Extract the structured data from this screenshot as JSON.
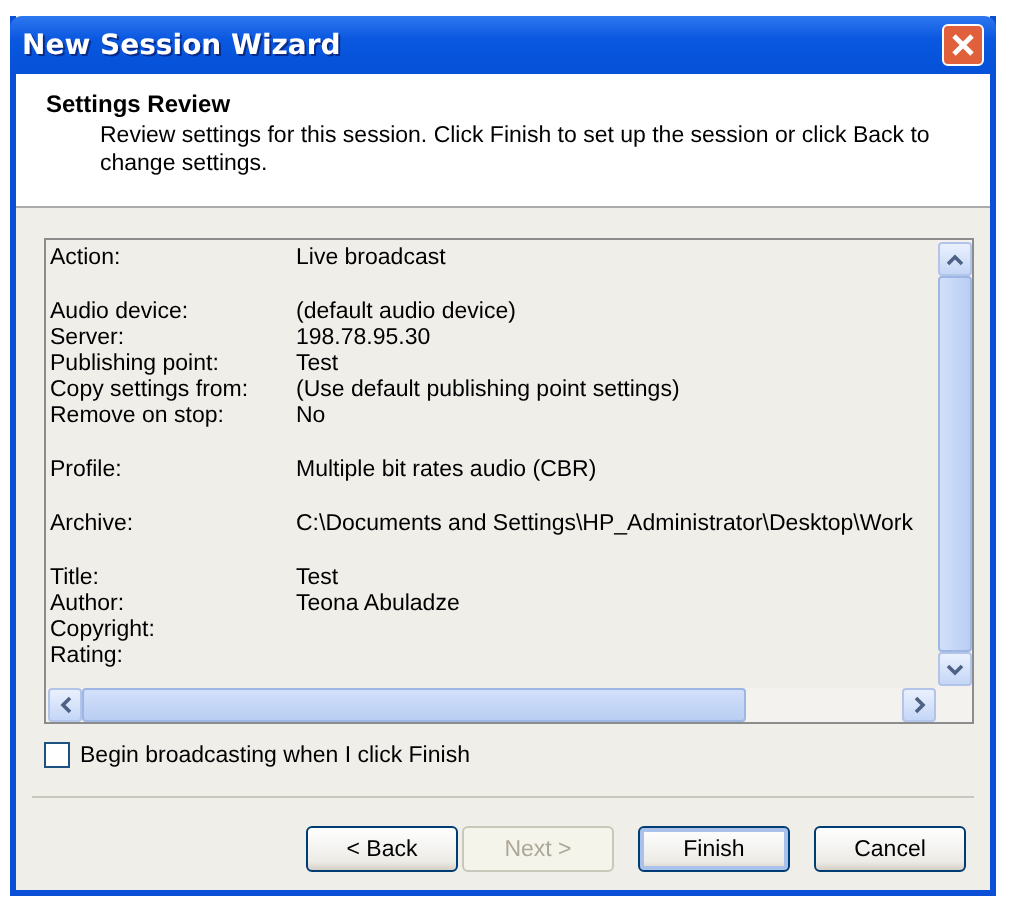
{
  "window": {
    "title": "New Session Wizard"
  },
  "header": {
    "title": "Settings Review",
    "description": "Review settings for this session. Click Finish to set up the session or click Back to change settings."
  },
  "settings": {
    "groups": [
      {
        "rows": [
          {
            "label": "Action:",
            "value": "Live broadcast"
          }
        ]
      },
      {
        "rows": [
          {
            "label": "Audio device:",
            "value": "(default audio device)"
          },
          {
            "label": "Server:",
            "value": "198.78.95.30"
          },
          {
            "label": "Publishing point:",
            "value": "Test"
          },
          {
            "label": "Copy settings from:",
            "value": "(Use default publishing point settings)"
          },
          {
            "label": "Remove on stop:",
            "value": "No"
          }
        ]
      },
      {
        "rows": [
          {
            "label": "Profile:",
            "value": "Multiple bit rates audio (CBR)"
          }
        ]
      },
      {
        "rows": [
          {
            "label": "Archive:",
            "value": "C:\\Documents and Settings\\HP_Administrator\\Desktop\\Work"
          }
        ]
      },
      {
        "rows": [
          {
            "label": "Title:",
            "value": "Test"
          },
          {
            "label": "Author:",
            "value": "Teona Abuladze"
          },
          {
            "label": "Copyright:"
          },
          {
            "label": "Rating:"
          }
        ]
      }
    ]
  },
  "checkbox": {
    "label": "Begin broadcasting when I click Finish",
    "checked": false
  },
  "buttons": [
    {
      "label": "< Back",
      "disabled": false,
      "default": false
    },
    {
      "label": "Next >",
      "disabled": true,
      "default": false
    },
    {
      "label": "Finish",
      "disabled": false,
      "default": true
    },
    {
      "label": "Cancel",
      "disabled": false,
      "default": false
    }
  ]
}
